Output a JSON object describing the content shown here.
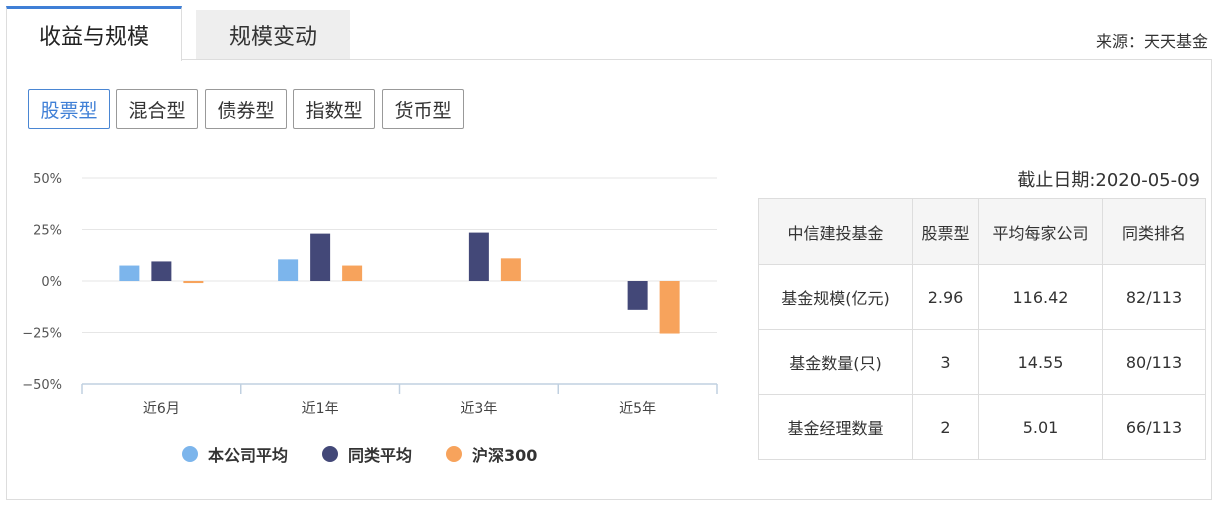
{
  "tabs": [
    {
      "label": "收益与规模",
      "active": true
    },
    {
      "label": "规模变动",
      "active": false
    }
  ],
  "source": "来源：天天基金",
  "filters": [
    {
      "label": "股票型",
      "active": true
    },
    {
      "label": "混合型",
      "active": false
    },
    {
      "label": "债券型",
      "active": false
    },
    {
      "label": "指数型",
      "active": false
    },
    {
      "label": "货币型",
      "active": false
    }
  ],
  "chart_data": {
    "type": "bar",
    "categories": [
      "近6月",
      "近1年",
      "近3年",
      "近5年"
    ],
    "series": [
      {
        "name": "本公司平均",
        "color": "#7cb5ec",
        "values": [
          7.5,
          10.5,
          null,
          null
        ]
      },
      {
        "name": "同类平均",
        "color": "#434878",
        "values": [
          9.5,
          23.0,
          23.5,
          -14.0
        ]
      },
      {
        "name": "沪深300",
        "color": "#f7a35c",
        "values": [
          -1.0,
          7.5,
          11.0,
          -25.5
        ]
      }
    ],
    "yticks": [
      "50%",
      "25%",
      "0%",
      "−25%",
      "−50%"
    ],
    "ylim": [
      -50,
      50
    ],
    "grid": true,
    "legend_position": "bottom-center"
  },
  "table": {
    "as_of": "截止日期:2020-05-09",
    "headers": [
      "中信建投基金",
      "股票型",
      "平均每家公司",
      "同类排名"
    ],
    "rows": [
      [
        "基金规模(亿元)",
        "2.96",
        "116.42",
        "82/113"
      ],
      [
        "基金数量(只)",
        "3",
        "14.55",
        "80/113"
      ],
      [
        "基金经理数量",
        "2",
        "5.01",
        "66/113"
      ]
    ]
  }
}
